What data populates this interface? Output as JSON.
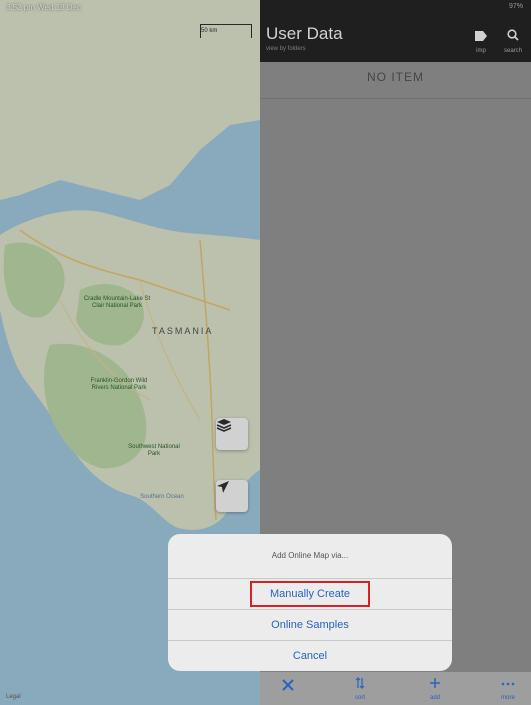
{
  "status_bar": {
    "time_date": "3:52 pm  Wed 18 Dec",
    "battery": "97%"
  },
  "map": {
    "scale_label": "50 km",
    "region_label": "TASMANIA",
    "places": [
      "Cradle Mountain-Lake St Clair National Park",
      "Franklin-Gordon Wild Rivers National Park",
      "Southwest National Park",
      "Southern Ocean"
    ],
    "legal": "Legal",
    "colors": {
      "water": "#a8d0e6",
      "land": "#e4ecd2",
      "park": "#c4dfae"
    }
  },
  "header": {
    "title": "User Data",
    "subtitle": "view by folders",
    "imp_label": "imp",
    "search_label": "search"
  },
  "list": {
    "empty_text": "NO ITEM"
  },
  "action_sheet": {
    "title": "Add Online Map via...",
    "options": [
      "Manually Create",
      "Online Samples",
      "Cancel"
    ],
    "highlight_color": "#d52222"
  },
  "toolbar": {
    "close_icon": "close-icon",
    "sort_label": "sort",
    "add_label": "add",
    "more_label": "more"
  },
  "colors": {
    "accent": "#2a60c7",
    "header_bg": "#262626"
  }
}
